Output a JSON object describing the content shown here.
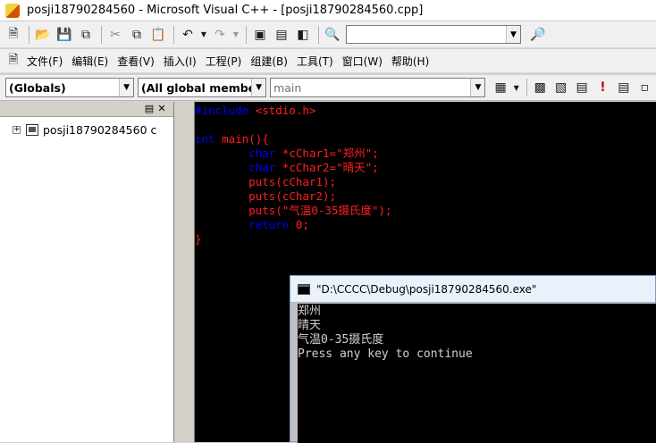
{
  "window": {
    "title": "posji18790284560 - Microsoft Visual C++ - [posji18790284560.cpp]"
  },
  "menubar": {
    "items": [
      "文件(F)",
      "编辑(E)",
      "查看(V)",
      "插入(I)",
      "工程(P)",
      "组建(B)",
      "工具(T)",
      "窗口(W)",
      "帮助(H)"
    ]
  },
  "wizardbar": {
    "class_combo": "(Globals)",
    "filter_combo": "(All global members",
    "member_combo": "main"
  },
  "workspace": {
    "project_name": "posji18790284560 c"
  },
  "editor": {
    "lines": [
      {
        "parts": [
          {
            "t": "#include ",
            "c": "kw"
          },
          {
            "t": "<stdio.h>",
            "c": "rd"
          }
        ]
      },
      {
        "parts": []
      },
      {
        "parts": [
          {
            "t": "int ",
            "c": "kw"
          },
          {
            "t": "main(){",
            "c": "rd"
          }
        ]
      },
      {
        "parts": [
          {
            "t": "        "
          },
          {
            "t": "char ",
            "c": "kw"
          },
          {
            "t": "*cChar1=\"郑州\";",
            "c": "rd"
          }
        ]
      },
      {
        "parts": [
          {
            "t": "        "
          },
          {
            "t": "char ",
            "c": "kw"
          },
          {
            "t": "*cChar2=\"晴天\";",
            "c": "rd"
          }
        ]
      },
      {
        "parts": [
          {
            "t": "        "
          },
          {
            "t": "puts(cChar1);",
            "c": "rd"
          }
        ]
      },
      {
        "parts": [
          {
            "t": "        "
          },
          {
            "t": "puts(cChar2);",
            "c": "rd"
          }
        ]
      },
      {
        "parts": [
          {
            "t": "        "
          },
          {
            "t": "puts(\"气温0-35摄氏度\");",
            "c": "rd"
          }
        ]
      },
      {
        "parts": [
          {
            "t": "        "
          },
          {
            "t": "return ",
            "c": "kw"
          },
          {
            "t": "0;",
            "c": "rd"
          }
        ]
      },
      {
        "parts": [
          {
            "t": "}",
            "c": "rd"
          }
        ]
      }
    ]
  },
  "console": {
    "title": "\"D:\\CCCC\\Debug\\posji18790284560.exe\"",
    "lines": [
      "郑州",
      "晴天",
      "气温0-35摄氏度",
      "Press any key to continue"
    ]
  }
}
